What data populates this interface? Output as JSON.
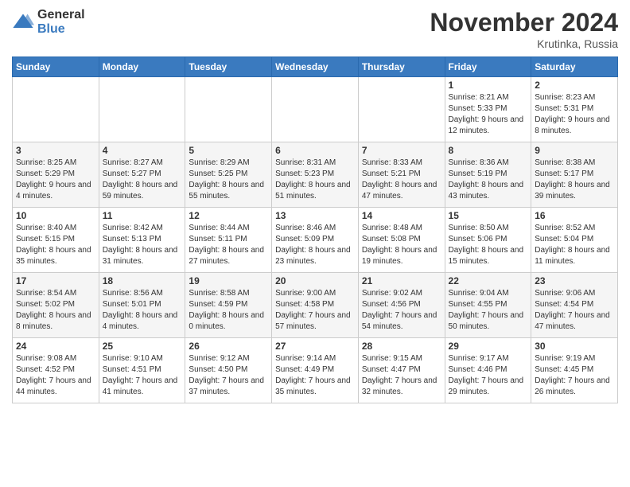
{
  "logo": {
    "general": "General",
    "blue": "Blue"
  },
  "title": "November 2024",
  "subtitle": "Krutinka, Russia",
  "days_header": [
    "Sunday",
    "Monday",
    "Tuesday",
    "Wednesday",
    "Thursday",
    "Friday",
    "Saturday"
  ],
  "weeks": [
    [
      {
        "day": "",
        "info": ""
      },
      {
        "day": "",
        "info": ""
      },
      {
        "day": "",
        "info": ""
      },
      {
        "day": "",
        "info": ""
      },
      {
        "day": "",
        "info": ""
      },
      {
        "day": "1",
        "info": "Sunrise: 8:21 AM\nSunset: 5:33 PM\nDaylight: 9 hours and 12 minutes."
      },
      {
        "day": "2",
        "info": "Sunrise: 8:23 AM\nSunset: 5:31 PM\nDaylight: 9 hours and 8 minutes."
      }
    ],
    [
      {
        "day": "3",
        "info": "Sunrise: 8:25 AM\nSunset: 5:29 PM\nDaylight: 9 hours and 4 minutes."
      },
      {
        "day": "4",
        "info": "Sunrise: 8:27 AM\nSunset: 5:27 PM\nDaylight: 8 hours and 59 minutes."
      },
      {
        "day": "5",
        "info": "Sunrise: 8:29 AM\nSunset: 5:25 PM\nDaylight: 8 hours and 55 minutes."
      },
      {
        "day": "6",
        "info": "Sunrise: 8:31 AM\nSunset: 5:23 PM\nDaylight: 8 hours and 51 minutes."
      },
      {
        "day": "7",
        "info": "Sunrise: 8:33 AM\nSunset: 5:21 PM\nDaylight: 8 hours and 47 minutes."
      },
      {
        "day": "8",
        "info": "Sunrise: 8:36 AM\nSunset: 5:19 PM\nDaylight: 8 hours and 43 minutes."
      },
      {
        "day": "9",
        "info": "Sunrise: 8:38 AM\nSunset: 5:17 PM\nDaylight: 8 hours and 39 minutes."
      }
    ],
    [
      {
        "day": "10",
        "info": "Sunrise: 8:40 AM\nSunset: 5:15 PM\nDaylight: 8 hours and 35 minutes."
      },
      {
        "day": "11",
        "info": "Sunrise: 8:42 AM\nSunset: 5:13 PM\nDaylight: 8 hours and 31 minutes."
      },
      {
        "day": "12",
        "info": "Sunrise: 8:44 AM\nSunset: 5:11 PM\nDaylight: 8 hours and 27 minutes."
      },
      {
        "day": "13",
        "info": "Sunrise: 8:46 AM\nSunset: 5:09 PM\nDaylight: 8 hours and 23 minutes."
      },
      {
        "day": "14",
        "info": "Sunrise: 8:48 AM\nSunset: 5:08 PM\nDaylight: 8 hours and 19 minutes."
      },
      {
        "day": "15",
        "info": "Sunrise: 8:50 AM\nSunset: 5:06 PM\nDaylight: 8 hours and 15 minutes."
      },
      {
        "day": "16",
        "info": "Sunrise: 8:52 AM\nSunset: 5:04 PM\nDaylight: 8 hours and 11 minutes."
      }
    ],
    [
      {
        "day": "17",
        "info": "Sunrise: 8:54 AM\nSunset: 5:02 PM\nDaylight: 8 hours and 8 minutes."
      },
      {
        "day": "18",
        "info": "Sunrise: 8:56 AM\nSunset: 5:01 PM\nDaylight: 8 hours and 4 minutes."
      },
      {
        "day": "19",
        "info": "Sunrise: 8:58 AM\nSunset: 4:59 PM\nDaylight: 8 hours and 0 minutes."
      },
      {
        "day": "20",
        "info": "Sunrise: 9:00 AM\nSunset: 4:58 PM\nDaylight: 7 hours and 57 minutes."
      },
      {
        "day": "21",
        "info": "Sunrise: 9:02 AM\nSunset: 4:56 PM\nDaylight: 7 hours and 54 minutes."
      },
      {
        "day": "22",
        "info": "Sunrise: 9:04 AM\nSunset: 4:55 PM\nDaylight: 7 hours and 50 minutes."
      },
      {
        "day": "23",
        "info": "Sunrise: 9:06 AM\nSunset: 4:54 PM\nDaylight: 7 hours and 47 minutes."
      }
    ],
    [
      {
        "day": "24",
        "info": "Sunrise: 9:08 AM\nSunset: 4:52 PM\nDaylight: 7 hours and 44 minutes."
      },
      {
        "day": "25",
        "info": "Sunrise: 9:10 AM\nSunset: 4:51 PM\nDaylight: 7 hours and 41 minutes."
      },
      {
        "day": "26",
        "info": "Sunrise: 9:12 AM\nSunset: 4:50 PM\nDaylight: 7 hours and 37 minutes."
      },
      {
        "day": "27",
        "info": "Sunrise: 9:14 AM\nSunset: 4:49 PM\nDaylight: 7 hours and 35 minutes."
      },
      {
        "day": "28",
        "info": "Sunrise: 9:15 AM\nSunset: 4:47 PM\nDaylight: 7 hours and 32 minutes."
      },
      {
        "day": "29",
        "info": "Sunrise: 9:17 AM\nSunset: 4:46 PM\nDaylight: 7 hours and 29 minutes."
      },
      {
        "day": "30",
        "info": "Sunrise: 9:19 AM\nSunset: 4:45 PM\nDaylight: 7 hours and 26 minutes."
      }
    ]
  ]
}
